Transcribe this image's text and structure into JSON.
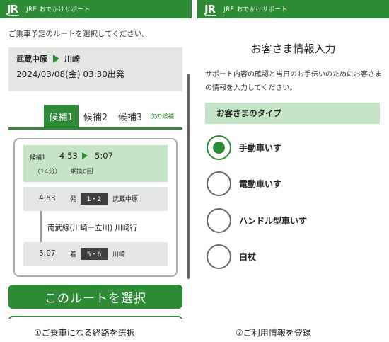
{
  "brand": {
    "logo_text": "JR",
    "app_name": "JRE おでかけサポート",
    "accent_color": "#2e8b36",
    "light_green": "#c4e5c6"
  },
  "left_screen": {
    "instruction": "ご乗車予定のルートを選択してください。",
    "route": {
      "from": "武蔵中原",
      "to": "川崎",
      "datetime": "2024/03/08(金) 03:30出発"
    },
    "tabs": [
      {
        "label": "候補1",
        "active": true
      },
      {
        "label": "候補2",
        "active": false
      },
      {
        "label": "候補3",
        "active": false
      }
    ],
    "next_candidates_link": "次の候補",
    "candidate": {
      "label": "候補1",
      "depart_time": "4:53",
      "arrive_time": "5:07",
      "duration": "（14分）",
      "transfers": "乗換0回"
    },
    "departure_stop": {
      "time": "4:53",
      "tag": "発",
      "platform": "1・2",
      "station": "武蔵中原"
    },
    "line_name": "南武線(川崎ー立川) 川崎行",
    "arrival_stop": {
      "time": "5:07",
      "tag": "着",
      "platform": "5・6",
      "station": "川崎"
    },
    "select_button": "このルートを選択"
  },
  "right_screen": {
    "title": "お客さま情報入力",
    "description": "サポート内容の確認と当日のお手伝いのためにお客さまの情報を入力してください。",
    "section_header": "お客さまのタイプ",
    "options": [
      {
        "label": "手動車いす",
        "checked": true
      },
      {
        "label": "電動車いす",
        "checked": false
      },
      {
        "label": "ハンドル型車いす",
        "checked": false
      },
      {
        "label": "白杖",
        "checked": false
      }
    ]
  },
  "captions": {
    "left": "①ご乗車になる経路を選択",
    "right": "②ご利用情報を登録"
  }
}
